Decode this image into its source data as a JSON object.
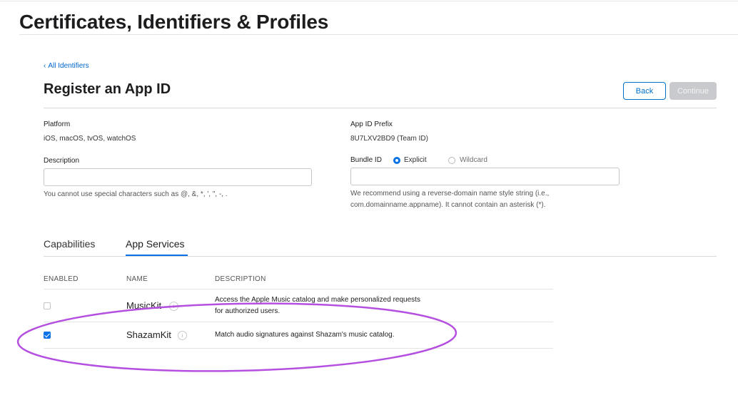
{
  "header": {
    "app_title": "Certificates, Identifiers & Profiles"
  },
  "nav": {
    "back_link_chevron": "‹",
    "back_link_label": "All Identifiers"
  },
  "page": {
    "title": "Register an App ID"
  },
  "buttons": {
    "back_label": "Back",
    "continue_label": "Continue"
  },
  "form": {
    "platform_label": "Platform",
    "platform_value": "iOS, macOS, tvOS, watchOS",
    "prefix_label": "App ID Prefix",
    "prefix_value": "8U7LXV2BD9 (Team ID)",
    "description_label": "Description",
    "description_value": "",
    "description_hint": "You cannot use special characters such as @, &, *, ', \", -, .",
    "bundle_label": "Bundle ID",
    "bundle_option_explicit": "Explicit",
    "bundle_option_wildcard": "Wildcard",
    "bundle_selected": "Explicit",
    "bundle_value": "",
    "bundle_hint": "We recommend using a reverse-domain name style string (i.e., com.domainname.appname). It cannot contain an asterisk (*)."
  },
  "tabs": [
    {
      "label": "Capabilities",
      "active": false
    },
    {
      "label": "App Services",
      "active": true
    }
  ],
  "table": {
    "columns": [
      "ENABLED",
      "NAME",
      "DESCRIPTION"
    ],
    "rows": [
      {
        "enabled": false,
        "name": "MusicKit",
        "info_icon": "info-icon",
        "description": "Access the Apple Music catalog and make personalized requests for authorized users."
      },
      {
        "enabled": true,
        "name": "ShazamKit",
        "info_icon": "info-icon",
        "description": "Match audio signatures against Shazam's music catalog."
      }
    ]
  },
  "colors": {
    "accent": "#0a72e8",
    "link": "#0066cc",
    "annotation": "#b54fe0",
    "disabled_button": "#c8cacd"
  }
}
